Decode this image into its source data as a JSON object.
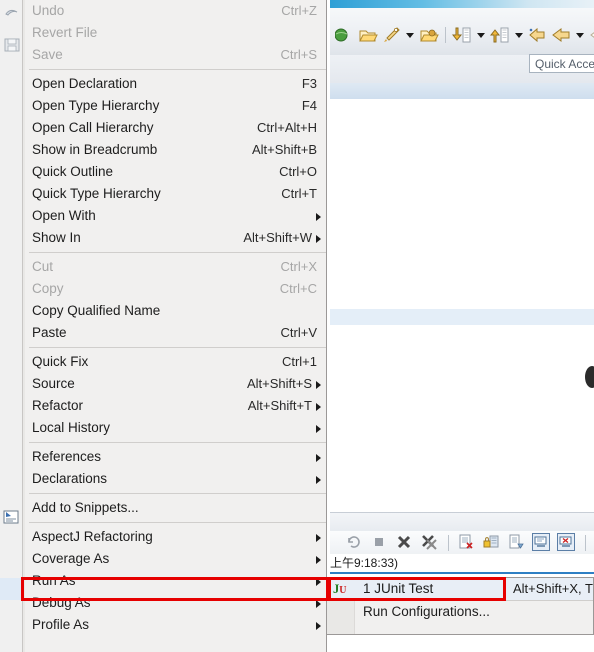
{
  "ide": {
    "quick_access": {
      "value": "",
      "placeholder": "Quick Acce"
    },
    "console_timestamp": "上午9:18:33)",
    "toolbar_icons": [
      "globe-icon",
      "open-folder-icon",
      "run-rocket-icon",
      "dropdown-caret-icon",
      "open-type-icon",
      "toolbar-separator",
      "import-down-icon",
      "dropdown-caret-icon",
      "export-up-icon",
      "dropdown-caret-icon",
      "back-arrow-icon",
      "forward-arrow-icon",
      "dropdown-caret-icon",
      "next-arrow-icon"
    ],
    "view_toolbar_icons": [
      "relaunch-icon",
      "terminate-icon",
      "remove-launch-icon",
      "remove-all-launches-icon",
      "toolbar-separator",
      "clear-console-icon",
      "lock-scroll-icon",
      "pin-console-icon",
      "display-selected-console-icon",
      "open-console-icon",
      "toolbar-separator",
      "new-console-view-icon"
    ],
    "gutter_icons": [
      "undo-icon",
      "save-disk-icon",
      "add-to-snippets-icon"
    ]
  },
  "context_menu": {
    "groups": [
      {
        "items": [
          {
            "label": "Undo",
            "accel": "Ctrl+Z",
            "disabled": true,
            "submenu": false
          },
          {
            "label": "Revert File",
            "accel": "",
            "disabled": true,
            "submenu": false
          },
          {
            "label": "Save",
            "accel": "Ctrl+S",
            "disabled": true,
            "submenu": false
          }
        ]
      },
      {
        "items": [
          {
            "label": "Open Declaration",
            "accel": "F3",
            "disabled": false,
            "submenu": false
          },
          {
            "label": "Open Type Hierarchy",
            "accel": "F4",
            "disabled": false,
            "submenu": false
          },
          {
            "label": "Open Call Hierarchy",
            "accel": "Ctrl+Alt+H",
            "disabled": false,
            "submenu": false
          },
          {
            "label": "Show in Breadcrumb",
            "accel": "Alt+Shift+B",
            "disabled": false,
            "submenu": false
          },
          {
            "label": "Quick Outline",
            "accel": "Ctrl+O",
            "disabled": false,
            "submenu": false
          },
          {
            "label": "Quick Type Hierarchy",
            "accel": "Ctrl+T",
            "disabled": false,
            "submenu": false
          },
          {
            "label": "Open With",
            "accel": "",
            "disabled": false,
            "submenu": true
          },
          {
            "label": "Show In",
            "accel": "Alt+Shift+W",
            "disabled": false,
            "submenu": true
          }
        ]
      },
      {
        "items": [
          {
            "label": "Cut",
            "accel": "Ctrl+X",
            "disabled": true,
            "submenu": false
          },
          {
            "label": "Copy",
            "accel": "Ctrl+C",
            "disabled": true,
            "submenu": false
          },
          {
            "label": "Copy Qualified Name",
            "accel": "",
            "disabled": false,
            "submenu": false
          },
          {
            "label": "Paste",
            "accel": "Ctrl+V",
            "disabled": false,
            "submenu": false
          }
        ]
      },
      {
        "items": [
          {
            "label": "Quick Fix",
            "accel": "Ctrl+1",
            "disabled": false,
            "submenu": false
          },
          {
            "label": "Source",
            "accel": "Alt+Shift+S",
            "disabled": false,
            "submenu": true
          },
          {
            "label": "Refactor",
            "accel": "Alt+Shift+T",
            "disabled": false,
            "submenu": true
          },
          {
            "label": "Local History",
            "accel": "",
            "disabled": false,
            "submenu": true
          }
        ]
      },
      {
        "items": [
          {
            "label": "References",
            "accel": "",
            "disabled": false,
            "submenu": true
          },
          {
            "label": "Declarations",
            "accel": "",
            "disabled": false,
            "submenu": true
          }
        ]
      },
      {
        "items": [
          {
            "label": "Add to Snippets...",
            "accel": "",
            "disabled": false,
            "submenu": false
          }
        ]
      },
      {
        "items": [
          {
            "label": "AspectJ Refactoring",
            "accel": "",
            "disabled": false,
            "submenu": true
          },
          {
            "label": "Coverage As",
            "accel": "",
            "disabled": false,
            "submenu": true
          },
          {
            "label": "Run As",
            "accel": "",
            "disabled": false,
            "submenu": true,
            "highlighted": true
          },
          {
            "label": "Debug As",
            "accel": "",
            "disabled": false,
            "submenu": true
          },
          {
            "label": "Profile As",
            "accel": "",
            "disabled": false,
            "submenu": true
          }
        ]
      }
    ]
  },
  "run_as_submenu": {
    "items": [
      {
        "label": "1 JUnit Test",
        "accel": "Alt+Shift+X, T",
        "icon": "junit-icon",
        "selected": true
      },
      {
        "label": "Run Configurations...",
        "accel": "",
        "icon": "",
        "selected": false
      }
    ],
    "junit_icon_text": {
      "j": "J",
      "u": "U"
    }
  },
  "annotations": {
    "highlight_color": "#e60000",
    "boxes": [
      {
        "name": "run-as-highlight-box"
      },
      {
        "name": "junit-test-highlight-box"
      }
    ]
  }
}
